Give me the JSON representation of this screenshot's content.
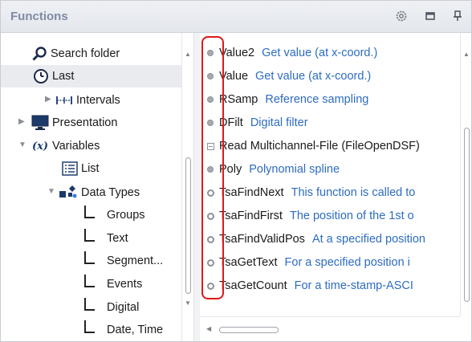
{
  "panel": {
    "title": "Functions"
  },
  "toolbar": {
    "icons": [
      "gear-icon",
      "maximize-icon",
      "pin-icon"
    ]
  },
  "tree": {
    "items": [
      {
        "label": "Search folder",
        "icon": "search-icon"
      },
      {
        "label": "Last",
        "icon": "clock-icon",
        "selected": true
      },
      {
        "label": "Intervals",
        "icon": "intervals-icon",
        "expand": "collapsed"
      },
      {
        "label": "Presentation",
        "icon": "monitor-icon",
        "expand": "collapsed"
      },
      {
        "label": "Variables",
        "icon": "variable-x-icon",
        "glyph": "(x)",
        "expand": "expanded"
      },
      {
        "label": "List",
        "icon": "list-icon"
      },
      {
        "label": "Data Types",
        "icon": "data-types-icon",
        "expand": "expanded"
      },
      {
        "label": "Groups"
      },
      {
        "label": "Text"
      },
      {
        "label": "Segment..."
      },
      {
        "label": "Events"
      },
      {
        "label": "Digital"
      },
      {
        "label": "Date, Time"
      }
    ]
  },
  "functions": [
    {
      "name": "Value2",
      "desc": "Get value (at x-coord.)",
      "bullet": "dot"
    },
    {
      "name": "Value",
      "desc": "Get value (at x-coord.)",
      "bullet": "dot"
    },
    {
      "name": "RSamp",
      "desc": "Reference sampling",
      "bullet": "dot"
    },
    {
      "name": "DFilt",
      "desc": "Digital filter",
      "bullet": "dot"
    },
    {
      "name": "Read Multichannel-File (FileOpenDSF)",
      "desc": "",
      "bullet": "box"
    },
    {
      "name": "Poly",
      "desc": "Polynomial spline",
      "bullet": "dot"
    },
    {
      "name": "TsaFindNext",
      "desc": "This function is called to",
      "bullet": "ring"
    },
    {
      "name": "TsaFindFirst",
      "desc": "The position of the 1st o",
      "bullet": "ring"
    },
    {
      "name": "TsaFindValidPos",
      "desc": "At a specified position",
      "bullet": "ring"
    },
    {
      "name": "TsaGetText",
      "desc": "For a specified position i",
      "bullet": "ring"
    },
    {
      "name": "TsaGetCount",
      "desc": "For a time-stamp-ASCI",
      "bullet": "ring"
    }
  ],
  "colors": {
    "title_text": "#7f8aa3",
    "description_text": "#2d6cc0",
    "highlight_border": "#e01818",
    "selected_row": "#e9ebee"
  }
}
